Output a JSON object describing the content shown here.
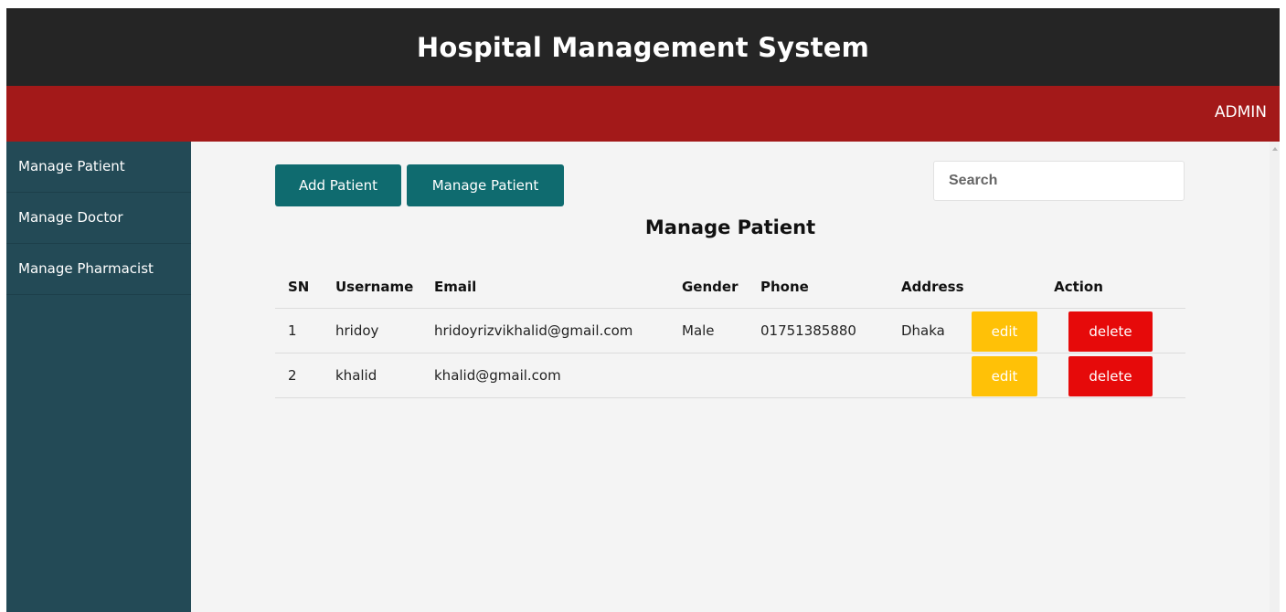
{
  "header": {
    "title": "Hospital Management System"
  },
  "subheader": {
    "user_label": "ADMIN"
  },
  "sidebar": {
    "items": [
      {
        "label": "Manage Patient"
      },
      {
        "label": "Manage Doctor"
      },
      {
        "label": "Manage Pharmacist"
      }
    ]
  },
  "toolbar": {
    "add_label": "Add Patient",
    "manage_label": "Manage Patient"
  },
  "search": {
    "placeholder": "Search",
    "value": ""
  },
  "page": {
    "heading": "Manage Patient"
  },
  "table": {
    "columns": {
      "sn": "SN",
      "username": "Username",
      "email": "Email",
      "gender": "Gender",
      "phone": "Phone",
      "address": "Address",
      "action": "Action"
    },
    "edit_label": "edit",
    "delete_label": "delete",
    "rows": [
      {
        "sn": "1",
        "username": "hridoy",
        "email": "hridoyrizvikhalid@gmail.com",
        "gender": "Male",
        "phone": "01751385880",
        "address": "Dhaka"
      },
      {
        "sn": "2",
        "username": "khalid",
        "email": "khalid@gmail.com",
        "gender": "",
        "phone": "",
        "address": ""
      }
    ]
  },
  "colors": {
    "header_bg": "#252525",
    "subheader_bg": "#a31919",
    "sidebar_bg": "#234a56",
    "primary_button": "#0f6b6f",
    "edit_button": "#ffc107",
    "delete_button": "#e60a0a"
  }
}
